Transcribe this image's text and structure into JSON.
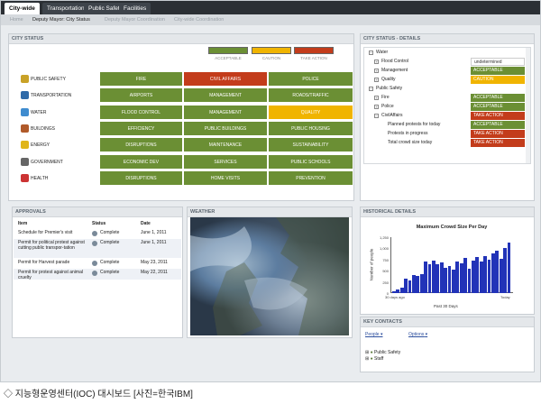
{
  "tabs": [
    "City-wide",
    "Transportation",
    "Public Safety",
    "Facilities"
  ],
  "subnav": [
    "Home",
    "Deputy Mayor: City Status",
    "Deputy Mayor Coordination",
    "City-wide Coordination"
  ],
  "city_status": {
    "title": "CITY STATUS",
    "legend": [
      "ACCEPTABLE",
      "CAUTION",
      "TAKE ACTION"
    ],
    "rows": [
      {
        "label": "PUBLIC SAFETY",
        "icon": "shield-icon",
        "cells": [
          [
            "FIRE",
            "green"
          ],
          [
            "CIVIL AFFAIRS",
            "red"
          ],
          [
            "POLICE",
            "green"
          ]
        ]
      },
      {
        "label": "TRANSPORTATION",
        "icon": "bus-icon",
        "cells": [
          [
            "AIRPORTS",
            "green"
          ],
          [
            "MANAGEMENT",
            "green"
          ],
          [
            "ROADS/TRAFFIC",
            "green"
          ]
        ]
      },
      {
        "label": "WATER",
        "icon": "faucet-icon",
        "cells": [
          [
            "FLOOD CONTROL",
            "green"
          ],
          [
            "MANAGEMENT",
            "green"
          ],
          [
            "QUALITY",
            "yellow"
          ]
        ]
      },
      {
        "label": "BUILDINGS",
        "icon": "building-icon",
        "cells": [
          [
            "EFFICIENCY",
            "green"
          ],
          [
            "PUBLIC BUILDINGS",
            "green"
          ],
          [
            "PUBLIC HOUSING",
            "green"
          ]
        ]
      },
      {
        "label": "ENERGY",
        "icon": "lightning-icon",
        "cells": [
          [
            "DISRUPTIONS",
            "green"
          ],
          [
            "MAINTENANCE",
            "green"
          ],
          [
            "SUSTAINABILITY",
            "green"
          ]
        ]
      },
      {
        "label": "GOVERNMENT",
        "icon": "capitol-icon",
        "cells": [
          [
            "ECONOMIC DEV",
            "green"
          ],
          [
            "SERVICES",
            "green"
          ],
          [
            "PUBLIC SCHOOLS",
            "green"
          ]
        ]
      },
      {
        "label": "HEALTH",
        "icon": "medical-cross-icon",
        "cells": [
          [
            "DISRUPTIONS",
            "green"
          ],
          [
            "HOME VISITS",
            "green"
          ],
          [
            "PREVENTION",
            "green"
          ]
        ]
      }
    ]
  },
  "details": {
    "title": "CITY STATUS - DETAILS",
    "rows": [
      {
        "text": "Water",
        "level": 0,
        "pm": "−"
      },
      {
        "text": "Flood Control",
        "level": 1,
        "pm": "+",
        "status": "undetermined",
        "color": "undet"
      },
      {
        "text": "Management",
        "level": 1,
        "pm": "+",
        "status": "ACCEPTABLE",
        "color": "green"
      },
      {
        "text": "Quality",
        "level": 1,
        "pm": "+",
        "status": "CAUTION",
        "color": "yellow"
      },
      {
        "text": "Public Safety",
        "level": 0,
        "pm": "−"
      },
      {
        "text": "Fire",
        "level": 1,
        "pm": "+",
        "status": "ACCEPTABLE",
        "color": "green"
      },
      {
        "text": "Police",
        "level": 1,
        "pm": "+",
        "status": "ACCEPTABLE",
        "color": "green"
      },
      {
        "text": "CivilAffairs",
        "level": 1,
        "pm": "−",
        "status": "TAKE ACTION",
        "color": "red"
      },
      {
        "text": "Planned protests for today",
        "level": 2,
        "status": "ACCEPTABLE",
        "color": "green"
      },
      {
        "text": "Protests in progress",
        "level": 2,
        "status": "TAKE ACTION",
        "color": "red"
      },
      {
        "text": "Total crowd size today",
        "level": 2,
        "status": "TAKE ACTION",
        "color": "red"
      }
    ]
  },
  "approvals": {
    "title": "APPROVALS",
    "headers": [
      "Item",
      "Status",
      "Date"
    ],
    "rows": [
      {
        "item": "Schedule for Premier's visit",
        "status": "Complete",
        "date": "June 1, 2011"
      },
      {
        "item": "Permit for political protest against cutting public transpor-tation",
        "status": "Complete",
        "date": "June 1, 2011"
      },
      {
        "item": "Permit for Harvest parade",
        "status": "Complete",
        "date": "May 23, 2011"
      },
      {
        "item": "Permit for protest against animal cruelty",
        "status": "Complete",
        "date": "May 22, 2011"
      }
    ]
  },
  "weather": {
    "title": "WEATHER"
  },
  "historical": {
    "title": "HISTORICAL DETAILS",
    "chart_title": "Maximum Crowd Size Per Day",
    "ylabel": "Number of people",
    "xlabel": "Past 30 Days",
    "x_left": "30 days ago",
    "x_right": "Today",
    "yticks": [
      "1,250",
      "1,000",
      "750",
      "500",
      "250",
      "0"
    ]
  },
  "chart_data": {
    "type": "bar",
    "title": "Maximum Crowd Size Per Day",
    "xlabel": "Past 30 Days",
    "ylabel": "Number of people",
    "ylim": [
      0,
      1250
    ],
    "values": [
      50,
      80,
      120,
      320,
      280,
      400,
      380,
      420,
      700,
      650,
      720,
      640,
      680,
      560,
      600,
      520,
      700,
      660,
      780,
      540,
      720,
      800,
      700,
      820,
      740,
      880,
      940,
      760,
      1000,
      1120
    ]
  },
  "contacts": {
    "title": "KEY CONTACTS",
    "people": "People",
    "options": "Options",
    "groups": [
      "Public Safety",
      "Staff"
    ]
  },
  "caption": "◇ 지능형운영센터(IOC) 대시보드 [사진=한국IBM]"
}
